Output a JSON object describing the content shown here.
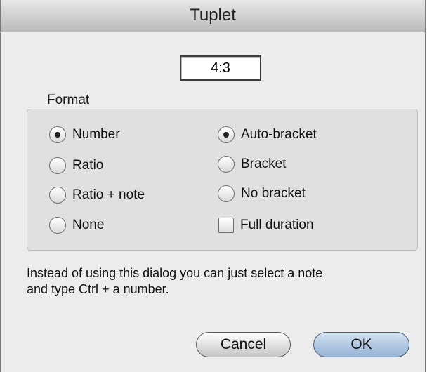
{
  "dialog": {
    "title": "Tuplet",
    "value": "4:3",
    "group_label": "Format",
    "format_options": [
      {
        "label": "Number",
        "checked": true
      },
      {
        "label": "Ratio",
        "checked": false
      },
      {
        "label": "Ratio + note",
        "checked": false
      },
      {
        "label": "None",
        "checked": false
      }
    ],
    "bracket_options": [
      {
        "label": "Auto-bracket",
        "checked": true
      },
      {
        "label": "Bracket",
        "checked": false
      },
      {
        "label": "No bracket",
        "checked": false
      }
    ],
    "full_duration": {
      "label": "Full duration",
      "checked": false
    },
    "help_line1": "Instead of using this dialog you can just select a note",
    "help_line2": "and type Ctrl + a number.",
    "cancel_label": "Cancel",
    "ok_label": "OK"
  }
}
